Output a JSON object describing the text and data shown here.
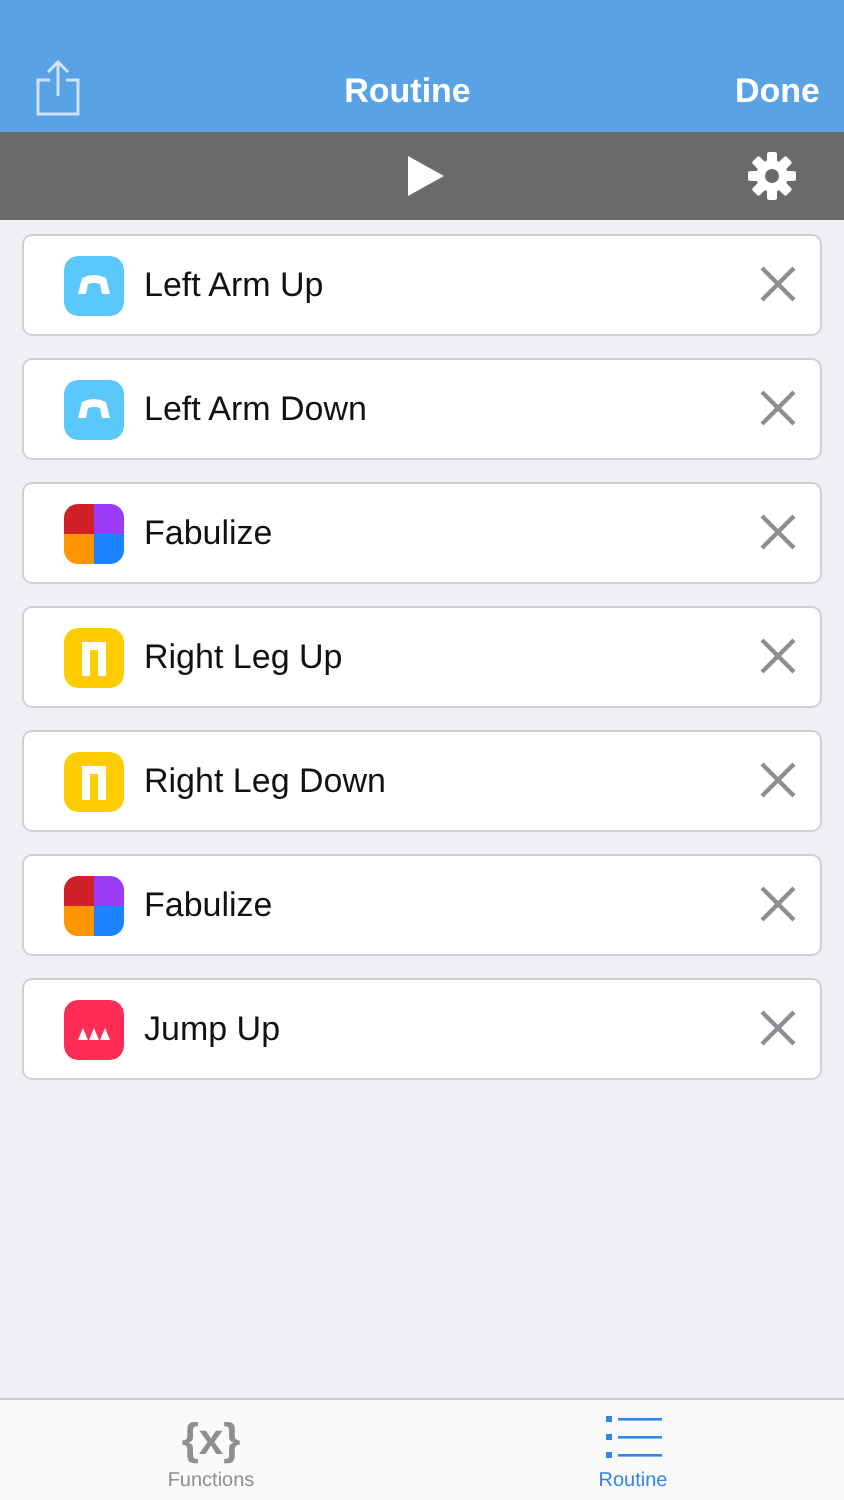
{
  "nav_bar": {
    "title": "Routine",
    "done": "Done"
  },
  "steps": [
    {
      "label": "Left Arm Up",
      "kind": "arm",
      "color": "#5ac8fa"
    },
    {
      "label": "Left Arm Down",
      "kind": "arm",
      "color": "#5ac8fa"
    },
    {
      "label": "Fabulize",
      "kind": "fabulize"
    },
    {
      "label": "Right Leg Up",
      "kind": "leg",
      "color": "#ffcc00"
    },
    {
      "label": "Right Leg Down",
      "kind": "leg",
      "color": "#ffcc00"
    },
    {
      "label": "Fabulize",
      "kind": "fabulize"
    },
    {
      "label": "Jump Up",
      "kind": "jump",
      "color": "#ff2d55"
    }
  ],
  "tab_bar": [
    {
      "label": "Functions",
      "icon_text": "{x}",
      "selected": false
    },
    {
      "label": "Routine",
      "selected": true
    }
  ]
}
